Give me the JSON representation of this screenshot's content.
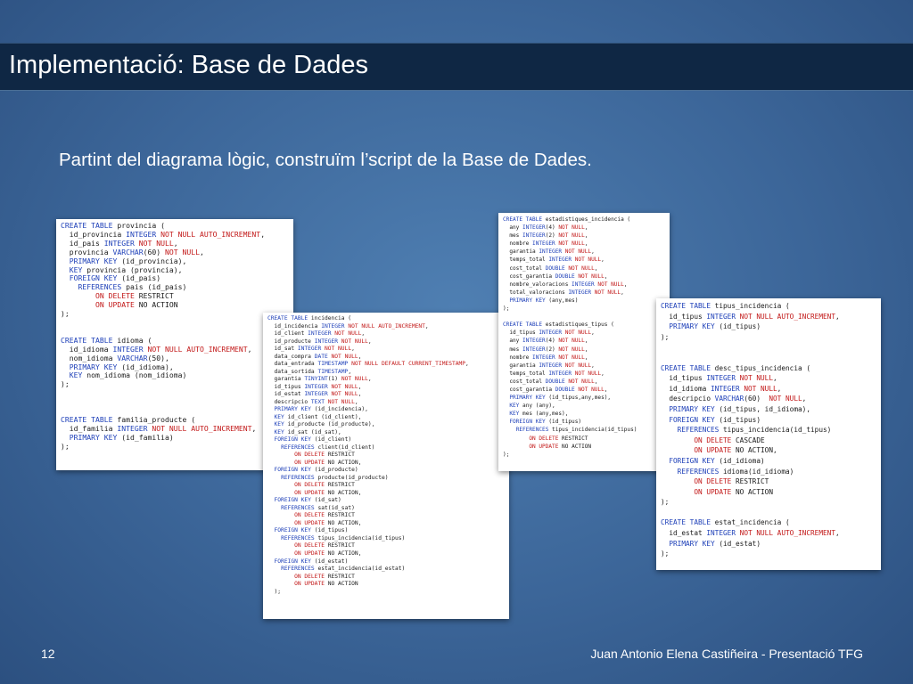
{
  "slide": {
    "title": "Implementació: Base de Dades",
    "subtitle": "Partint del diagrama lògic, construïm l’script de la Base de Dades.",
    "number": "12",
    "author": "Juan Antonio Elena Castiñeira - Presentació TFG"
  },
  "snippets": [
    {
      "name": "provincia-idioma-familia",
      "lines": [
        "CREATE TABLE provincia (",
        "  id_provincia INTEGER NOT NULL AUTO_INCREMENT,",
        "  id_pais INTEGER NOT NULL,",
        "  provincia VARCHAR(60) NOT NULL,",
        "  PRIMARY KEY (id_provincia),",
        "  KEY provincia (provincia),",
        "  FOREIGN KEY (id_pais)",
        "    REFERENCES pais (id_pais)",
        "        ON DELETE RESTRICT",
        "        ON UPDATE NO ACTION",
        ");",
        "",
        "",
        "CREATE TABLE idioma (",
        "  id_idioma INTEGER NOT NULL AUTO_INCREMENT,",
        "  nom_idioma VARCHAR(50),",
        "  PRIMARY KEY (id_idioma),",
        "  KEY nom_idioma (nom_idioma)",
        ");",
        "",
        "",
        "",
        "CREATE TABLE familia_producte (",
        "  id_familia INTEGER NOT NULL AUTO_INCREMENT,",
        "  PRIMARY KEY (id_familia)",
        ");"
      ]
    },
    {
      "name": "incidencia",
      "lines": [
        "CREATE TABLE incidencia (",
        "  id_incidencia INTEGER NOT NULL AUTO_INCREMENT,",
        "  id_client INTEGER NOT NULL,",
        "  id_producte INTEGER NOT NULL,",
        "  id_sat INTEGER NOT NULL,",
        "  data_compra DATE NOT NULL,",
        "  data_entrada TIMESTAMP NOT NULL DEFAULT CURRENT_TIMESTAMP,",
        "  data_sortida TIMESTAMP,",
        "  garantia TINYINT(1) NOT NULL,",
        "  id_tipus INTEGER NOT NULL,",
        "  id_estat INTEGER NOT NULL,",
        "  descripcio TEXT NOT NULL,",
        "  PRIMARY KEY (id_incidencia),",
        "  KEY id_client (id_client),",
        "  KEY id_producte (id_producte),",
        "  KEY id_sat (id_sat),",
        "  FOREIGN KEY (id_client)",
        "    REFERENCES client(id_client)",
        "        ON DELETE RESTRICT",
        "        ON UPDATE NO ACTION,",
        "  FOREIGN KEY (id_producte)",
        "    REFERENCES producte(id_producte)",
        "        ON DELETE RESTRICT",
        "        ON UPDATE NO ACTION,",
        "  FOREIGN KEY (id_sat)",
        "    REFERENCES sat(id_sat)",
        "        ON DELETE RESTRICT",
        "        ON UPDATE NO ACTION,",
        "  FOREIGN KEY (id_tipus)",
        "    REFERENCES tipus_incidencia(id_tipus)",
        "        ON DELETE RESTRICT",
        "        ON UPDATE NO ACTION,",
        "  FOREIGN KEY (id_estat)",
        "    REFERENCES estat_incidencia(id_estat)",
        "        ON DELETE RESTRICT",
        "        ON UPDATE NO ACTION",
        "  );",
        ""
      ]
    },
    {
      "name": "estadistiques",
      "lines": [
        "CREATE TABLE estadistiques_incidencia (",
        "  any INTEGER(4) NOT NULL,",
        "  mes INTEGER(2) NOT NULL,",
        "  nombre INTEGER NOT NULL,",
        "  garantia INTEGER NOT NULL,",
        "  temps_total INTEGER NOT NULL,",
        "  cost_total DOUBLE NOT NULL,",
        "  cost_garantia DOUBLE NOT NULL,",
        "  nombre_valoracions INTEGER NOT NULL,",
        "  total_valoracions INTEGER NOT NULL,",
        "  PRIMARY KEY (any,mes)",
        ");",
        "",
        "CREATE TABLE estadistiques_tipus (",
        "  id_tipus INTEGER NOT NULL,",
        "  any INTEGER(4) NOT NULL,",
        "  mes INTEGER(2) NOT NULL,",
        "  nombre INTEGER NOT NULL,",
        "  garantia INTEGER NOT NULL,",
        "  temps_total INTEGER NOT NULL,",
        "  cost_total DOUBLE NOT NULL,",
        "  cost_garantia DOUBLE NOT NULL,",
        "  PRIMARY KEY (id_tipus,any,mes),",
        "  KEY any (any),",
        "  KEY mes (any,mes),",
        "  FOREIGN KEY (id_tipus)",
        "    REFERENCES tipus_incidencia(id_tipus)",
        "        ON DELETE RESTRICT",
        "        ON UPDATE NO ACTION",
        ");"
      ]
    },
    {
      "name": "tipus-estat",
      "lines": [
        "CREATE TABLE tipus_incidencia (",
        "  id_tipus INTEGER NOT NULL AUTO_INCREMENT,",
        "  PRIMARY KEY (id_tipus)",
        ");",
        "",
        "",
        "CREATE TABLE desc_tipus_incidencia (",
        "  id_tipus INTEGER NOT NULL,",
        "  id_idioma INTEGER NOT NULL,",
        "  descripcio VARCHAR(60)  NOT NULL,",
        "  PRIMARY KEY (id_tipus, id_idioma),",
        "  FOREIGN KEY (id_tipus)",
        "    REFERENCES tipus_incidencia(id_tipus)",
        "        ON DELETE CASCADE",
        "        ON UPDATE NO ACTION,",
        "  FOREIGN KEY (id_idioma)",
        "    REFERENCES idioma(id_idioma)",
        "        ON DELETE RESTRICT",
        "        ON UPDATE NO ACTION",
        ");",
        "",
        "CREATE TABLE estat_incidencia (",
        "  id_estat INTEGER NOT NULL AUTO_INCREMENT,",
        "  PRIMARY KEY (id_estat)",
        ");"
      ]
    }
  ]
}
